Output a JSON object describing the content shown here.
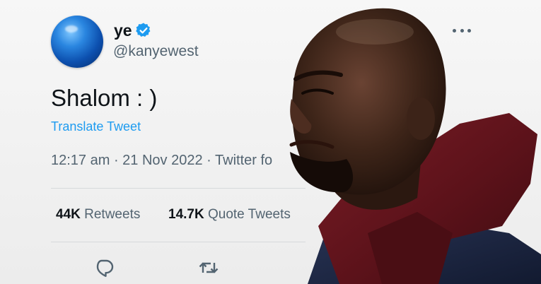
{
  "tweet": {
    "display_name": "ye",
    "handle": "@kanyewest",
    "text": "Shalom : )",
    "translate_label": "Translate Tweet",
    "time": "12:17 am",
    "date": "21 Nov 2022",
    "source": "Twitter fo",
    "stats": {
      "retweets_count": "44K",
      "retweets_label": "Retweets",
      "quotes_count": "14.7K",
      "quotes_label": "Quote Tweets"
    }
  },
  "icons": {
    "verified": "verified-badge-icon",
    "more": "more-options-icon",
    "reply": "reply-icon",
    "retweet": "retweet-icon"
  },
  "colors": {
    "verified_blue": "#1d9bf0",
    "link_blue": "#1d9bf0",
    "muted_text": "#536471"
  }
}
